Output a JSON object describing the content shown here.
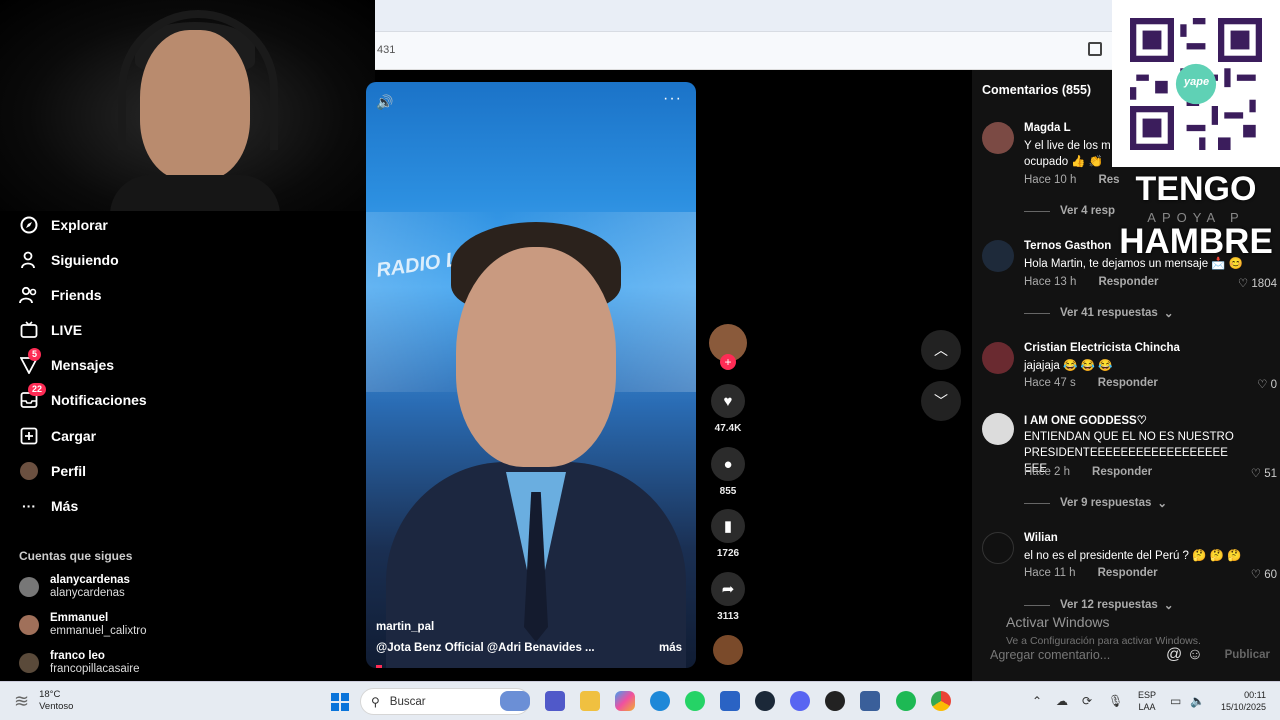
{
  "browser": {
    "url_fragment": "431"
  },
  "nav": {
    "items": [
      {
        "label": "Explorar",
        "icon": "compass-icon"
      },
      {
        "label": "Siguiendo",
        "icon": "user-icon"
      },
      {
        "label": "Friends",
        "icon": "friends-icon"
      },
      {
        "label": "LIVE",
        "icon": "live-icon"
      },
      {
        "label": "Mensajes",
        "icon": "messages-icon",
        "badge": "5"
      },
      {
        "label": "Notificaciones",
        "icon": "inbox-icon",
        "badge": "22"
      },
      {
        "label": "Cargar",
        "icon": "upload-icon"
      },
      {
        "label": "Perfil",
        "icon": "profile-icon"
      },
      {
        "label": "Más",
        "icon": "more-icon"
      }
    ],
    "following_title": "Cuentas que sigues",
    "accounts": [
      {
        "name": "alanycardenas",
        "handle": "alanycardenas"
      },
      {
        "name": "Emmanuel",
        "handle": "emmanuel_calixtro"
      },
      {
        "name": "franco leo",
        "handle": "francopillacasaire"
      }
    ]
  },
  "video": {
    "author": "martin_pal",
    "caption": "@Jota Benz Official  @Adri Benavides  ...",
    "more": "más",
    "logo_text": "RADIO LA Z",
    "likes": "47.4K",
    "comments": "855",
    "saves": "1726",
    "shares": "3113"
  },
  "comments": {
    "title": "Comentarios (855)",
    "items": [
      {
        "name": "Magda L",
        "text": "Y el live de los m ocupado 👍 👏",
        "time": "Hace 10 h",
        "reply": "Res",
        "likes": "",
        "more": "Ver 4 resp"
      },
      {
        "name": "Ternos Gasthon",
        "text": "Hola Martin, te dejamos un mensaje 📩 😊",
        "time": "Hace 13 h",
        "reply": "Responder",
        "likes": "1804",
        "more": "Ver 41 respuestas"
      },
      {
        "name": "Cristian Electricista Chincha",
        "text": "jajajaja 😂 😂 😂",
        "time": "Hace 47 s",
        "reply": "Responder",
        "likes": "0",
        "more": ""
      },
      {
        "name": "I AM ONE GODDESS♡",
        "text": "ENTIENDAN QUE EL NO ES NUESTRO PRESIDENTEEEEEEEEEEEEEEEEEEEEE",
        "time": "Hace 2 h",
        "reply": "Responder",
        "likes": "51",
        "more": "Ver 9 respuestas"
      },
      {
        "name": "Wilian",
        "text": "el no es el presidente del Perú ? 🤔 🤔 🤔",
        "time": "Hace 11 h",
        "reply": "Responder",
        "likes": "60",
        "more": "Ver 12 respuestas"
      }
    ],
    "add_placeholder": "Agregar comentario...",
    "publish": "Publicar"
  },
  "overlay": {
    "tengo": "TENGO",
    "apoya": "APOYA P",
    "hambre": "HAMBRE",
    "qr_brand": "yape"
  },
  "watermark": {
    "line1": "Activar Windows",
    "line2": "Ve a Configuración para activar Windows."
  },
  "taskbar": {
    "temp": "18°C",
    "weather": "Ventoso",
    "search": "Buscar",
    "lang1": "ESP",
    "lang2": "LAA",
    "time": "00:11",
    "date": "15/10/2025"
  }
}
